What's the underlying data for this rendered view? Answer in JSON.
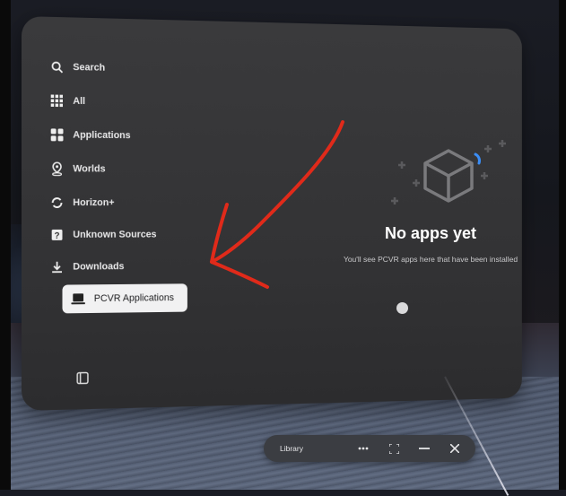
{
  "sidebar": {
    "items": [
      {
        "label": "Search",
        "icon": "search-icon"
      },
      {
        "label": "All",
        "icon": "grid-icon"
      },
      {
        "label": "Applications",
        "icon": "apps-icon"
      },
      {
        "label": "Worlds",
        "icon": "location-pin-icon"
      },
      {
        "label": "Horizon+",
        "icon": "horizon-plus-icon"
      },
      {
        "label": "Unknown Sources",
        "icon": "unknown-source-icon"
      },
      {
        "label": "Downloads",
        "icon": "download-icon"
      },
      {
        "label": "PCVR Applications",
        "icon": "laptop-icon",
        "active": true
      }
    ],
    "bottom_icon": "sidebar-toggle-icon"
  },
  "empty_state": {
    "title": "No apps yet",
    "subtitle": "You'll see PCVR apps here that have been installed",
    "icon": "cube-icon"
  },
  "taskbar": {
    "label": "Library",
    "buttons": [
      "more-icon",
      "fullscreen-icon",
      "minimize-icon",
      "close-icon"
    ]
  },
  "colors": {
    "panel": "#343436",
    "active_item_bg": "#f1f1f2",
    "annotation_arrow": "#e02a1a",
    "cube_accent": "#3b8df5"
  }
}
